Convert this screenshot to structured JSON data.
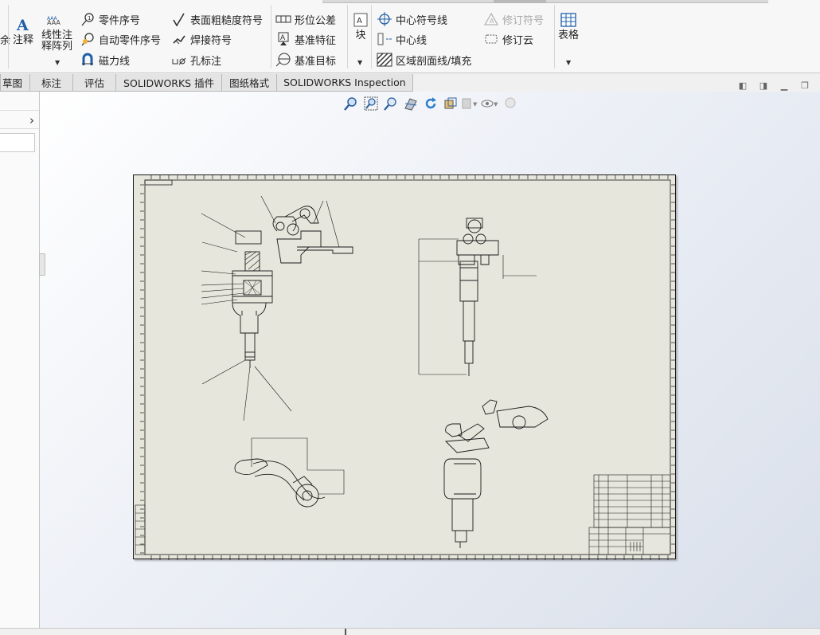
{
  "ribbon": {
    "cut_label": "余",
    "note": "注释",
    "linear_pattern_line1": "线性注",
    "linear_pattern_line2": "释阵列",
    "balloon": "零件序号",
    "auto_balloon": "自动零件序号",
    "magnetic_line": "磁力线",
    "surface_finish": "表面粗糙度符号",
    "weld_symbol": "焊接符号",
    "hole_callout": "孔标注",
    "gtol": "形位公差",
    "datum_feature": "基准特征",
    "datum_target": "基准目标",
    "block": "块",
    "center_mark": "中心符号线",
    "centerline": "中心线",
    "area_hatch": "区域剖面线/填充",
    "revision_symbol": "修订符号",
    "revision_cloud": "修订云",
    "table": "表格"
  },
  "tabs": [
    "草图",
    "标注",
    "评估",
    "SOLIDWORKS 插件",
    "图纸格式",
    "SOLIDWORKS Inspection"
  ],
  "view_tools": [
    "zoom-to-fit-icon",
    "zoom-to-area-icon",
    "previous-view-icon",
    "section-view-icon",
    "rotate-view-icon",
    "view-orientation-icon",
    "display-style-icon",
    "hide-show-items-icon",
    "edit-appearance-icon"
  ],
  "colors": {
    "sheet_bg": "#e6e6dc",
    "line": "#1b1b1b",
    "ribbon_blue": "#1f5fa8"
  }
}
